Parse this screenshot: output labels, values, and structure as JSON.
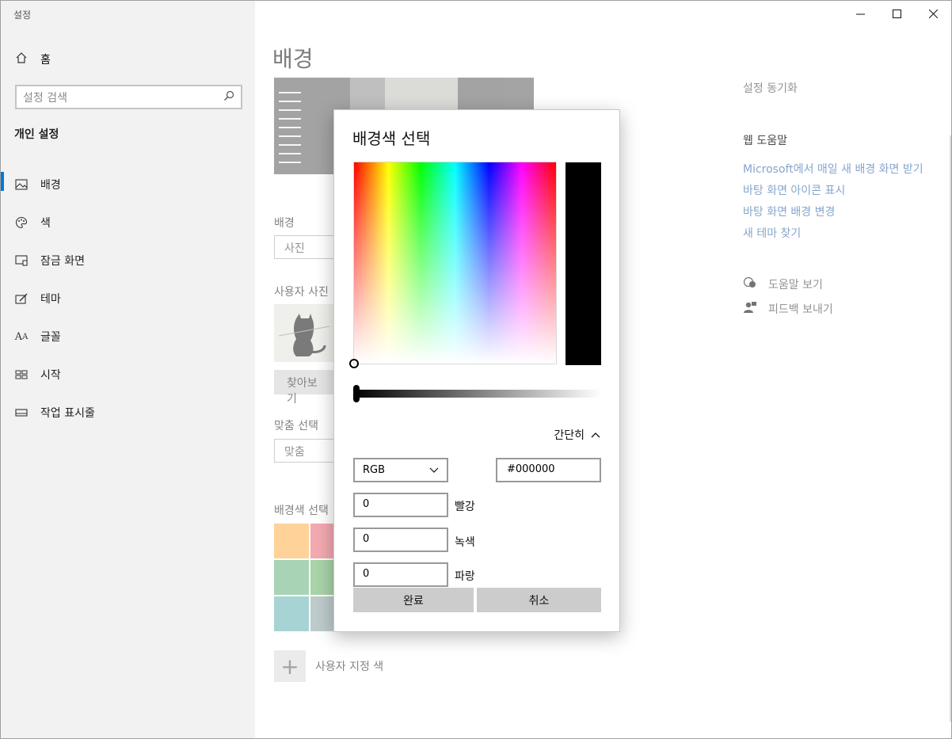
{
  "app": {
    "title": "설정"
  },
  "window_controls": {
    "minimize": "—",
    "maximize": "☐",
    "close": "✕"
  },
  "sidebar": {
    "home_label": "홈",
    "search_placeholder": "설정 검색",
    "section_title": "개인 설정",
    "items": [
      {
        "label": "배경",
        "icon": "picture-icon",
        "active": true
      },
      {
        "label": "색",
        "icon": "palette-icon",
        "active": false
      },
      {
        "label": "잠금 화면",
        "icon": "lock-screen-icon",
        "active": false
      },
      {
        "label": "테마",
        "icon": "theme-brush-icon",
        "active": false
      },
      {
        "label": "글꼴",
        "icon": "font-icon",
        "active": false
      },
      {
        "label": "시작",
        "icon": "start-tiles-icon",
        "active": false
      },
      {
        "label": "작업 표시줄",
        "icon": "taskbar-icon",
        "active": false
      }
    ],
    "accent_color": "#0078d4"
  },
  "main": {
    "page_title": "배경",
    "background_label": "배경",
    "background_value": "사진",
    "photo_label": "사용자 사진",
    "browse_label": "찾아보기",
    "fit_label": "맞춤 선택",
    "fit_value": "맞춤",
    "bg_color_label": "배경색 선택",
    "custom_color_label": "사용자 지정 색",
    "swatch_colors": [
      "#ffce8e",
      "#f2a0a8",
      "#9fd0ae",
      "#a0cfa0",
      "#9ecfd0",
      "#b8c6c6"
    ]
  },
  "right_pane": {
    "sync_link": "설정 동기화",
    "web_help_title": "웹 도움말",
    "links": [
      "Microsoft에서 매일 새 배경 화면 받기",
      "바탕 화면 아이콘 표시",
      "바탕 화면 배경 변경",
      "새 테마 찾기"
    ],
    "get_help": "도움말 보기",
    "feedback": "피드백 보내기"
  },
  "dialog": {
    "title": "배경색 선택",
    "less_label": "간단히",
    "mode_value": "RGB",
    "hex_value": "#000000",
    "red_value": "0",
    "red_label": "빨강",
    "green_value": "0",
    "green_label": "녹색",
    "blue_value": "0",
    "blue_label": "파랑",
    "done_label": "완료",
    "cancel_label": "취소",
    "selected_color": "#000000"
  }
}
